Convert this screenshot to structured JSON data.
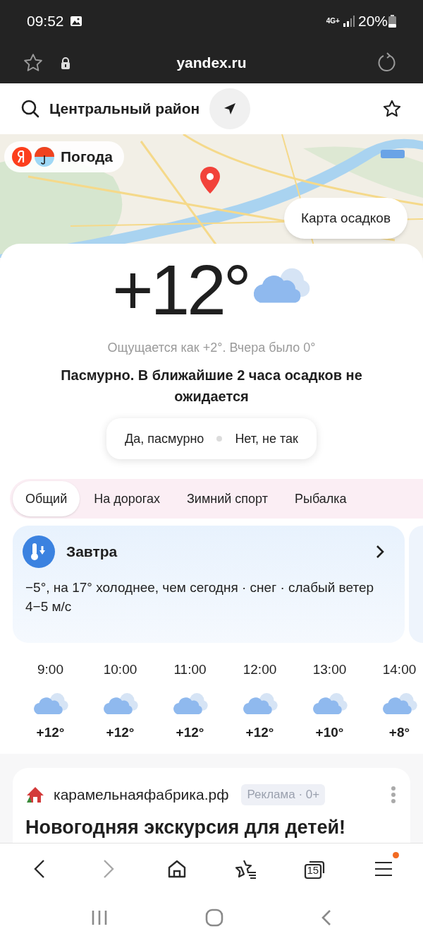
{
  "status_bar": {
    "time": "09:52",
    "network": "4G+",
    "battery": "20%"
  },
  "browser": {
    "url": "yandex.ru"
  },
  "location": {
    "name": "Центральный район"
  },
  "logo": {
    "text": "Погода"
  },
  "map": {
    "kind": "picture",
    "button": "Карта осадков"
  },
  "current": {
    "temperature": "+12",
    "degree": "°",
    "feels_like": "Ощущается как +2°. Вчера было 0°",
    "condition": "Пасмурно. В ближайшие 2 часа осадков не ожидается"
  },
  "feedback": [
    "Да, пасмурно",
    "Нет, не так"
  ],
  "tabs": [
    {
      "label": "Общий",
      "selected": true
    },
    {
      "label": "На дорогах",
      "selected": false
    },
    {
      "label": "Зимний спорт",
      "selected": false
    },
    {
      "label": "Рыбалка",
      "selected": false
    }
  ],
  "tomorrow": {
    "title": "Завтра",
    "text": "−5°, на 17° холоднее, чем сегодня · снег · слабый ветер 4−5 м/с"
  },
  "hourly": [
    {
      "time": "9:00",
      "temp": "+12°"
    },
    {
      "time": "10:00",
      "temp": "+12°"
    },
    {
      "time": "11:00",
      "temp": "+12°"
    },
    {
      "time": "12:00",
      "temp": "+12°"
    },
    {
      "time": "13:00",
      "temp": "+10°"
    },
    {
      "time": "14:00",
      "temp": "+8°"
    }
  ],
  "ad": {
    "domain": "карамельнаяфабрика.рф",
    "badge": "Реклама · 0+",
    "headline": "Новогодняя экскурсия для детей!"
  },
  "bottom_nav": [
    {
      "kind": "back",
      "disabled": false
    },
    {
      "kind": "forward",
      "disabled": true
    },
    {
      "kind": "home",
      "disabled": false
    },
    {
      "kind": "bookmarks",
      "disabled": false
    },
    {
      "kind": "tabs",
      "disabled": false,
      "count": "15"
    },
    {
      "kind": "menu",
      "disabled": false,
      "badge": true
    }
  ]
}
